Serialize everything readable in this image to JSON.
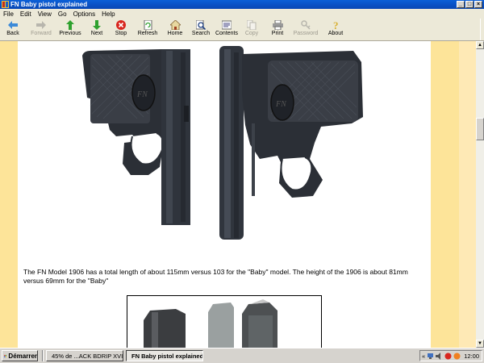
{
  "window": {
    "title": "FN Baby pistol explained"
  },
  "menu": [
    "File",
    "Edit",
    "View",
    "Go",
    "Options",
    "Help"
  ],
  "toolbar": [
    {
      "label": "Back",
      "icon": "back-arrow-icon",
      "enabled": true
    },
    {
      "label": "Forward",
      "icon": "forward-arrow-icon",
      "enabled": false
    },
    {
      "label": "Previous",
      "icon": "up-arrow-icon",
      "enabled": true
    },
    {
      "label": "Next",
      "icon": "down-arrow-icon",
      "enabled": true
    },
    {
      "label": "Stop",
      "icon": "stop-icon",
      "enabled": true
    },
    {
      "label": "Refresh",
      "icon": "refresh-icon",
      "enabled": true
    },
    {
      "label": "Home",
      "icon": "home-icon",
      "enabled": true
    },
    {
      "label": "Search",
      "icon": "search-icon",
      "enabled": true
    },
    {
      "label": "Contents",
      "icon": "contents-icon",
      "enabled": true
    },
    {
      "label": "Copy",
      "icon": "copy-icon",
      "enabled": false
    },
    {
      "label": "Print",
      "icon": "print-icon",
      "enabled": true
    },
    {
      "label": "Password",
      "icon": "password-icon",
      "enabled": false
    },
    {
      "label": "About",
      "icon": "about-icon",
      "enabled": true
    }
  ],
  "content": {
    "caption": "The FN Model 1906 has a total length of about 115mm versus 103 for the \"Baby\" model. The height of the 1906 is about 81mm versus 69mm for the \"Baby\""
  },
  "taskbar": {
    "start_label": "Démarrer",
    "tasks": [
      {
        "label": "45% de ...ACK BDRIP XVI...",
        "active": false
      },
      {
        "label": "FN Baby pistol explained",
        "active": true
      }
    ],
    "tray_arrow": "«",
    "clock": "12:00"
  },
  "colors": {
    "title_bar": "#0a5fd8",
    "chrome": "#ece9d8",
    "side_band": "#fde499",
    "taskbar": "#d6d3ce"
  }
}
